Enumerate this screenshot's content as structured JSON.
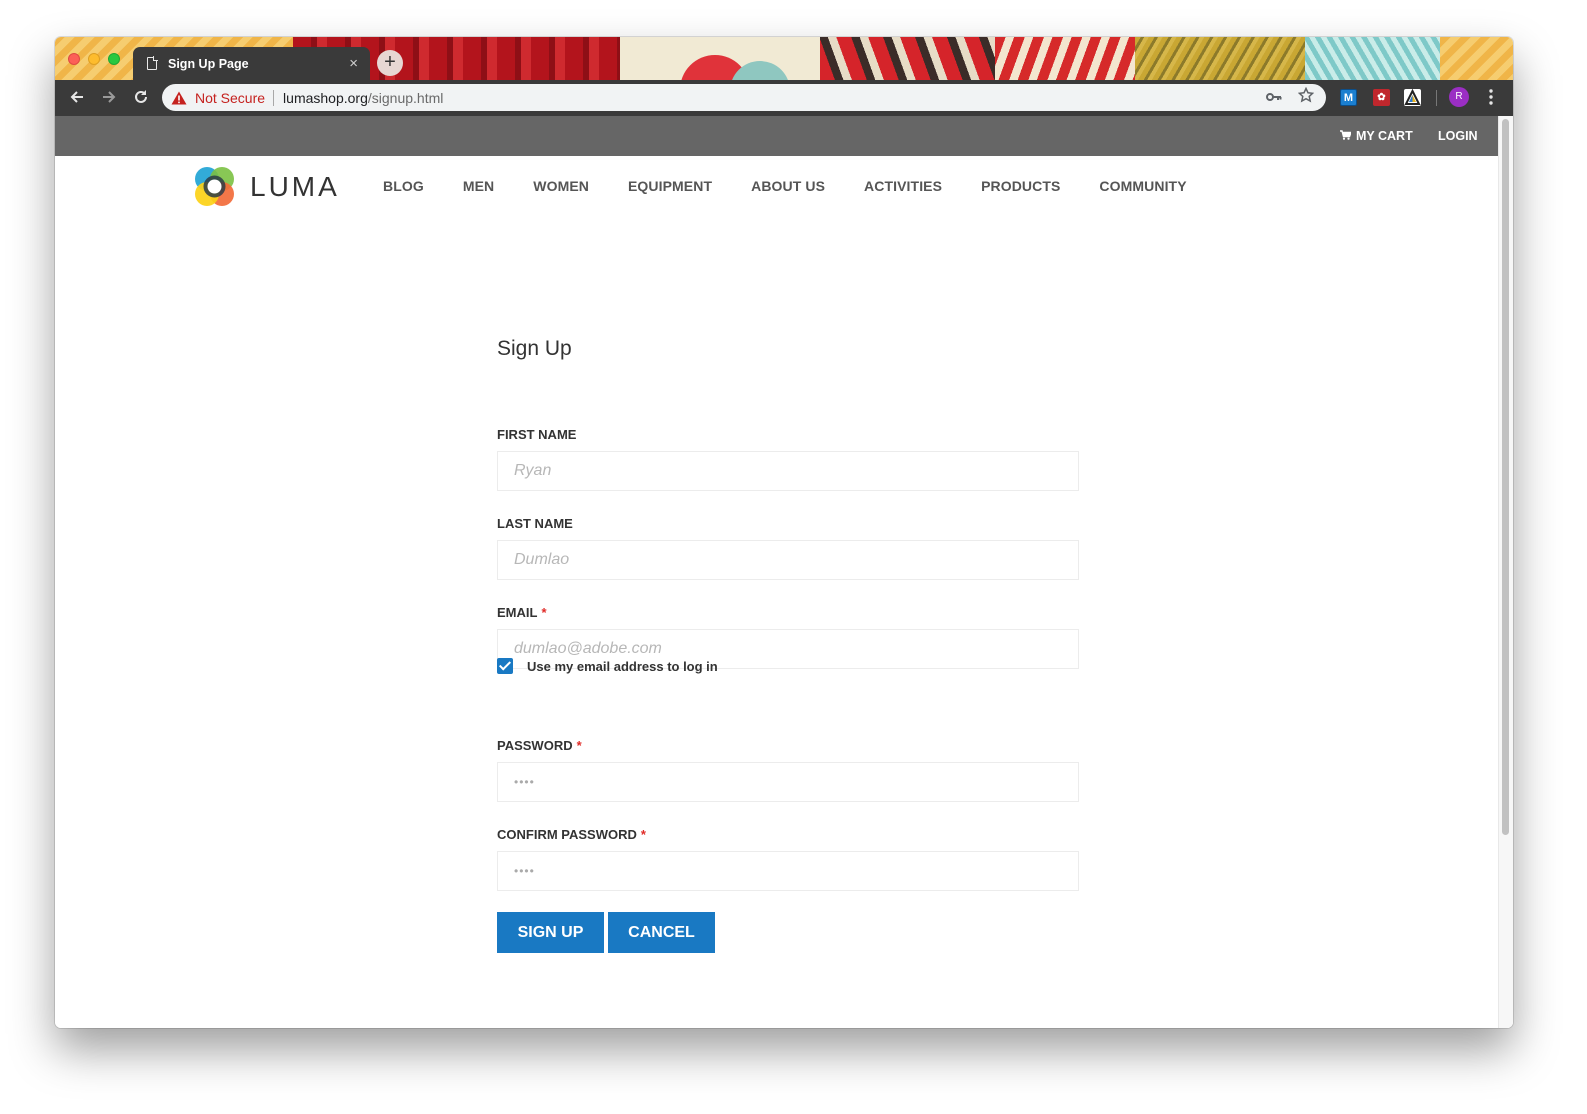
{
  "browser": {
    "tab_title": "Sign Up Page",
    "tab_close": "×",
    "new_tab": "+",
    "not_secure": "Not Secure",
    "url_host": "lumashop.org",
    "url_path": "/signup.html",
    "profile_initial": "R",
    "ext_m": "M",
    "ext_r": "✿"
  },
  "header": {
    "cart_label": "MY CART",
    "login_label": "LOGIN",
    "logo_text": "LUMA",
    "nav": [
      "BLOG",
      "MEN",
      "WOMEN",
      "EQUIPMENT",
      "ABOUT US",
      "ACTIVITIES",
      "PRODUCTS",
      "COMMUNITY"
    ]
  },
  "form": {
    "title": "Sign Up",
    "first_name_label": "FIRST NAME",
    "first_name_placeholder": "Ryan",
    "last_name_label": "LAST NAME",
    "last_name_placeholder": "Dumlao",
    "email_label": "EMAIL",
    "email_placeholder": "dumlao@adobe.com",
    "required_mark": "*",
    "use_email_label": "Use my email address to log in",
    "use_email_checked": true,
    "password_label": "PASSWORD",
    "password_placeholder": "••••",
    "confirm_password_label": "CONFIRM PASSWORD",
    "confirm_password_placeholder": "••••",
    "signup_button": "SIGN UP",
    "cancel_button": "CANCEL"
  },
  "colors": {
    "primary_button": "#1979c3",
    "topbar": "#666666",
    "required": "#e02b27",
    "not_secure": "#c5221f"
  }
}
